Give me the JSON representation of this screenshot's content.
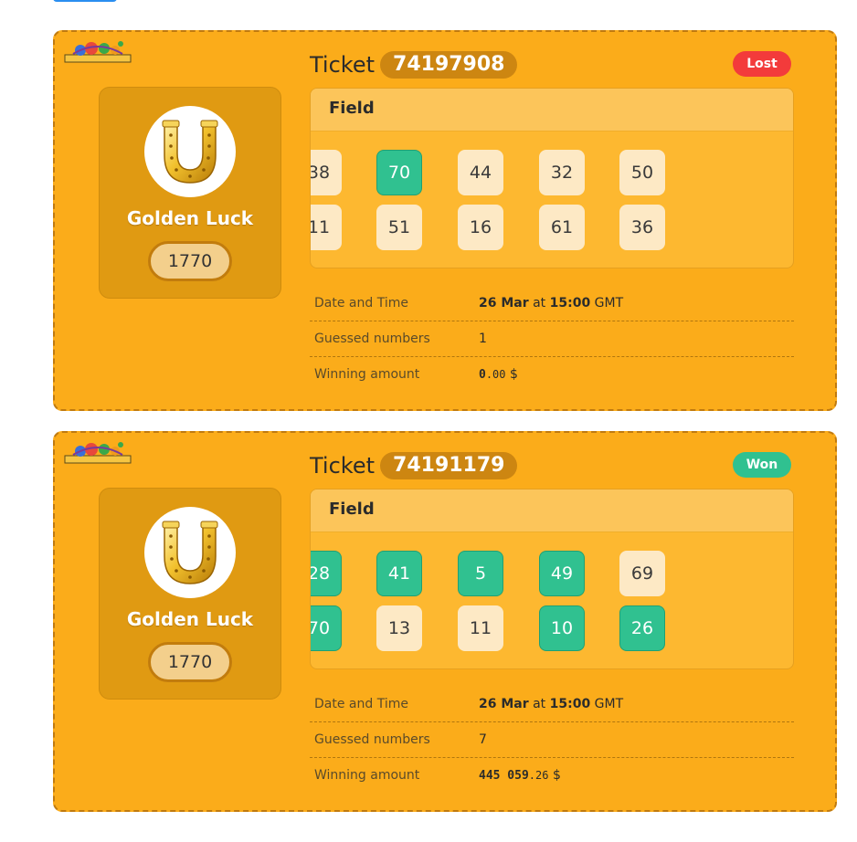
{
  "tickets": [
    {
      "title_word": "Ticket",
      "ticket_id": "74197908",
      "status": "Lost",
      "status_color": "#f33b3b",
      "game": {
        "name": "Golden Luck",
        "number": "1770",
        "icon": "horseshoe-icon"
      },
      "field": {
        "header": "Field",
        "numbers": [
          {
            "value": "38",
            "hit": false
          },
          {
            "value": "70",
            "hit": true
          },
          {
            "value": "44",
            "hit": false
          },
          {
            "value": "32",
            "hit": false
          },
          {
            "value": "50",
            "hit": false
          },
          {
            "value": "11",
            "hit": false
          },
          {
            "value": "51",
            "hit": false
          },
          {
            "value": "16",
            "hit": false
          },
          {
            "value": "61",
            "hit": false
          },
          {
            "value": "36",
            "hit": false
          }
        ]
      },
      "info": {
        "date_label": "Date and Time",
        "date_day": "26 Mar",
        "date_at": "at",
        "date_time": "15:00",
        "date_tz": "GMT",
        "guessed_label": "Guessed numbers",
        "guessed_value": "1",
        "amount_label": "Winning amount",
        "amount_int": "0",
        "amount_dec": ".00",
        "amount_currency": "$"
      }
    },
    {
      "title_word": "Ticket",
      "ticket_id": "74191179",
      "status": "Won",
      "status_color": "#30c190",
      "game": {
        "name": "Golden Luck",
        "number": "1770",
        "icon": "horseshoe-icon"
      },
      "field": {
        "header": "Field",
        "numbers": [
          {
            "value": "28",
            "hit": true
          },
          {
            "value": "41",
            "hit": true
          },
          {
            "value": "5",
            "hit": true
          },
          {
            "value": "49",
            "hit": true
          },
          {
            "value": "69",
            "hit": false
          },
          {
            "value": "70",
            "hit": true
          },
          {
            "value": "13",
            "hit": false
          },
          {
            "value": "11",
            "hit": false
          },
          {
            "value": "10",
            "hit": true
          },
          {
            "value": "26",
            "hit": true
          }
        ]
      },
      "info": {
        "date_label": "Date and Time",
        "date_day": "26 Mar",
        "date_at": "at",
        "date_time": "15:00",
        "date_tz": "GMT",
        "guessed_label": "Guessed numbers",
        "guessed_value": "7",
        "amount_label": "Winning amount",
        "amount_int": "445 059",
        "amount_dec": ".26",
        "amount_currency": "$"
      }
    }
  ]
}
